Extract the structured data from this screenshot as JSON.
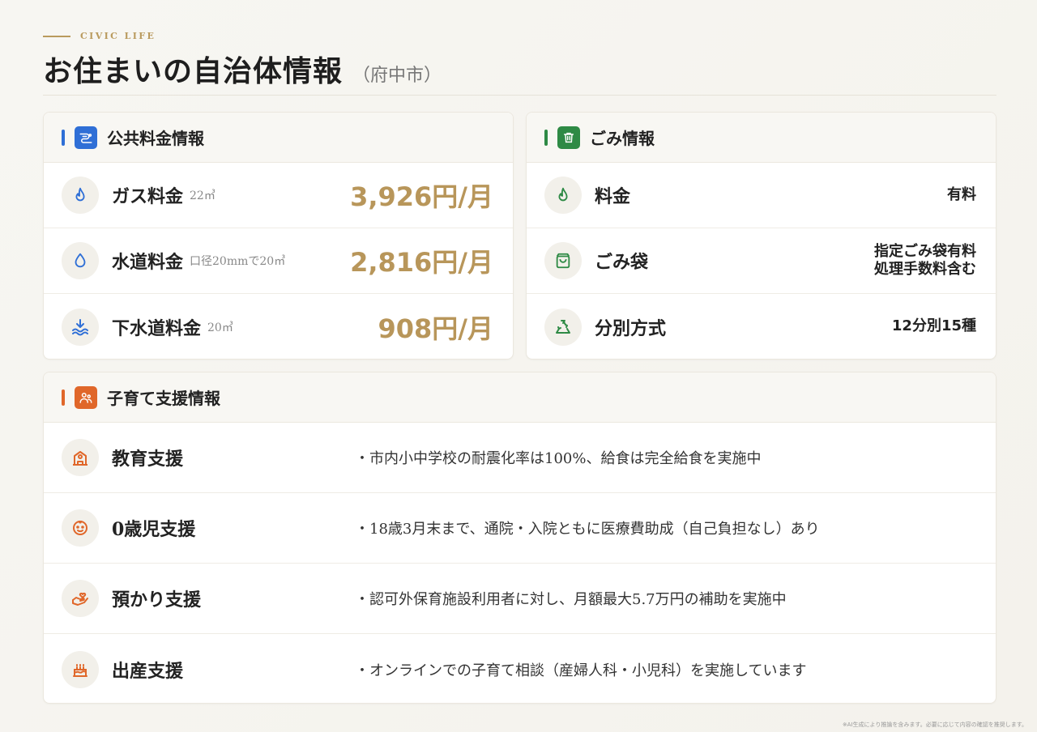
{
  "header": {
    "eyebrow": "CIVIC LIFE",
    "title": "お住まいの自治体情報",
    "subtitle": "（府中市）"
  },
  "utilities": {
    "title": "公共料金情報",
    "accent": "#2f6fd6",
    "items": [
      {
        "label": "ガス料金",
        "note": "22㎥",
        "value": "3,926円/月"
      },
      {
        "label": "水道料金",
        "note": "口径20mmで20㎥",
        "value": "2,816円/月"
      },
      {
        "label": "下水道料金",
        "note": "20㎥",
        "value": "908円/月"
      }
    ]
  },
  "garbage": {
    "title": "ごみ情報",
    "accent": "#2e8a45",
    "items": [
      {
        "label": "料金",
        "value": "有料"
      },
      {
        "label": "ごみ袋",
        "value_line1": "指定ごみ袋有料",
        "value_line2": "処理手数料含む"
      },
      {
        "label": "分別方式",
        "value": "12分別15種"
      }
    ]
  },
  "childcare": {
    "title": "子育て支援情報",
    "accent": "#e0672a",
    "items": [
      {
        "label": "教育支援",
        "text": "・市内小中学校の耐震化率は100%、給食は完全給食を実施中"
      },
      {
        "label": "0歳児支援",
        "text": "・18歳3月末まで、通院・入院ともに医療費助成（自己負担なし）あり"
      },
      {
        "label": "預かり支援",
        "text": "・認可外保育施設利用者に対し、月額最大5.7万円の補助を実施中"
      },
      {
        "label": "出産支援",
        "text": "・オンラインでの子育て相談（産婦人科・小児科）を実施しています"
      }
    ]
  },
  "footnote": "※AI生成により推論を含みます。必要に応じて内容の確認を推奨します。"
}
